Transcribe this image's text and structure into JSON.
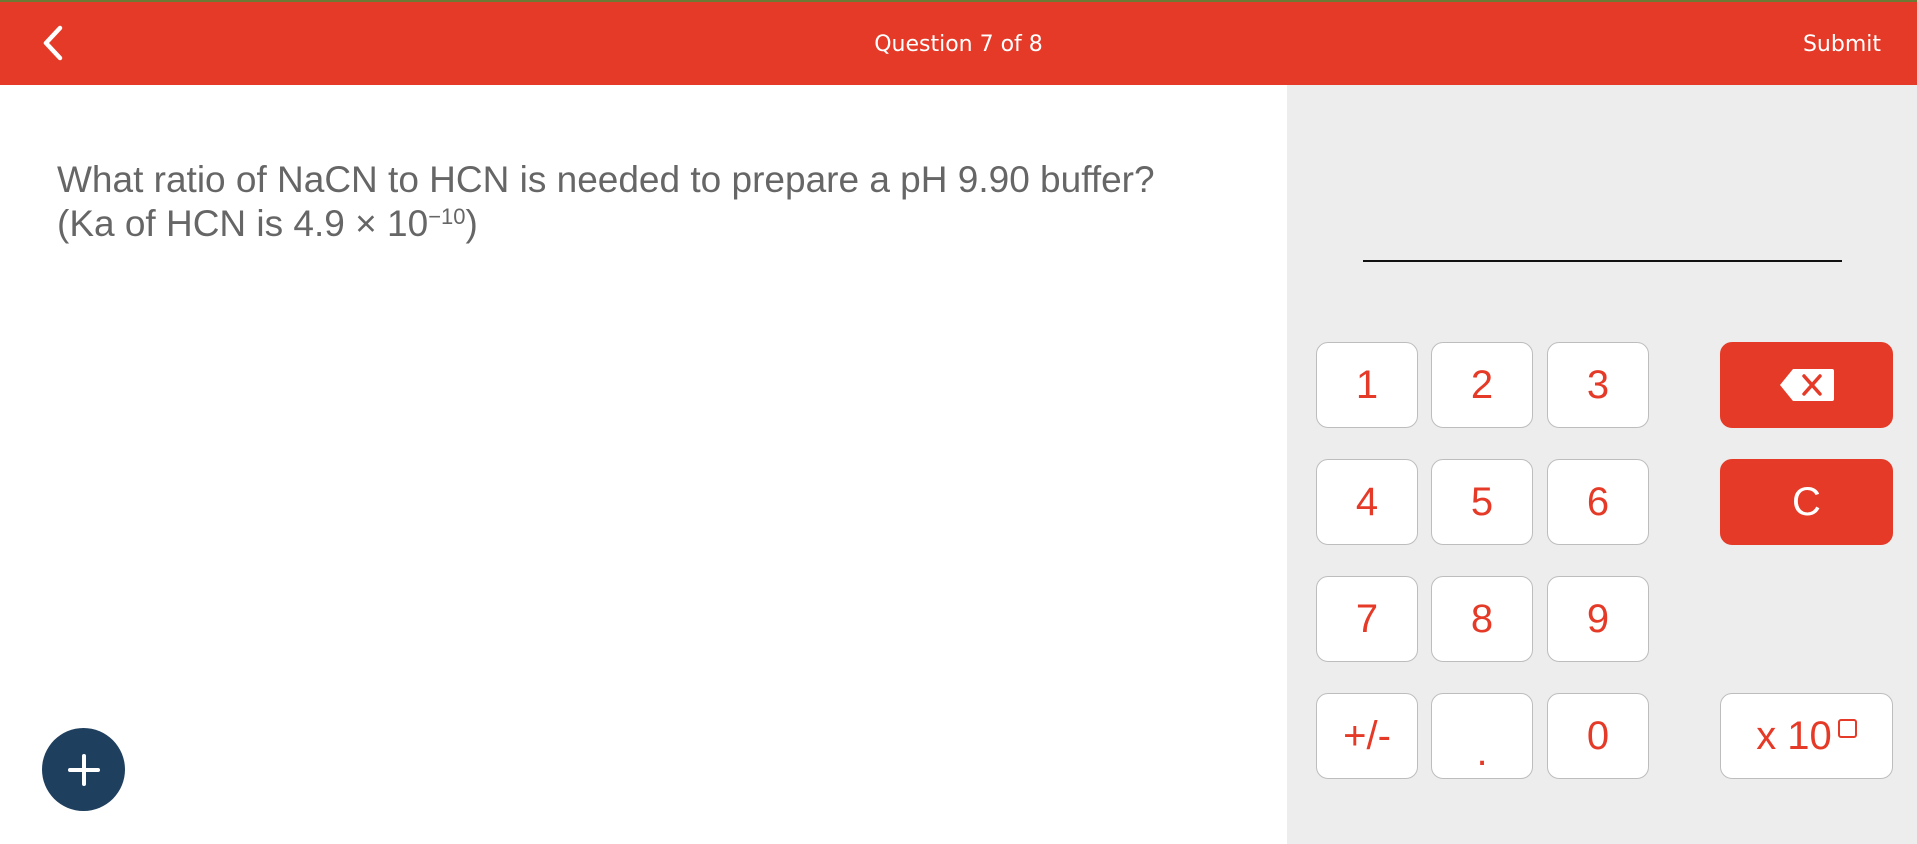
{
  "header": {
    "title": "Question 7 of 8",
    "submit_label": "Submit",
    "back_icon": "chevron-left-icon"
  },
  "question": {
    "line1": "What ratio of NaCN to HCN is needed to prepare a pH 9.90 buffer?",
    "line2_prefix": "(Ka of HCN is 4.9 × 10",
    "line2_exponent": "−10",
    "line2_suffix": ")"
  },
  "answer": {
    "value": ""
  },
  "keypad": {
    "digits": [
      "1",
      "2",
      "3",
      "4",
      "5",
      "6",
      "7",
      "8",
      "9"
    ],
    "plus_minus": "+/-",
    "decimal": ".",
    "zero": "0",
    "clear": "C",
    "backspace_icon": "backspace-icon",
    "sci_notation": "x 10"
  },
  "fab": {
    "icon": "plus-icon"
  },
  "colors": {
    "header": "#e53a27",
    "accent": "#e53a27",
    "panel_bg": "#ededed",
    "fab": "#1f3f5e",
    "question_text": "#666666"
  }
}
